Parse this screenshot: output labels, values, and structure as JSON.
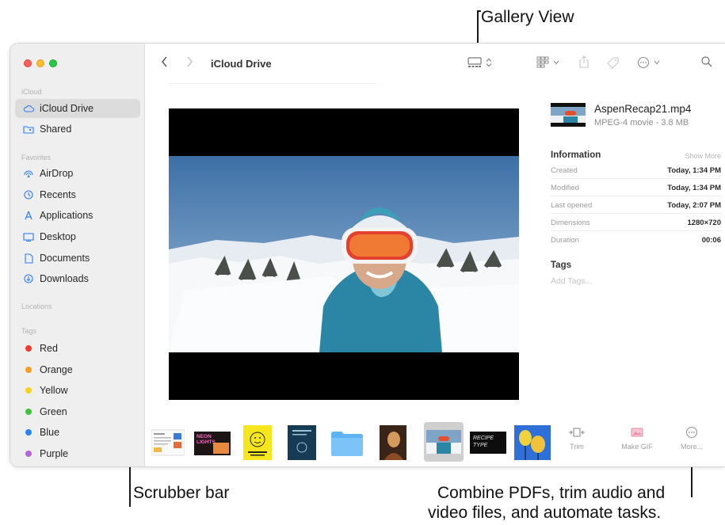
{
  "callouts": {
    "gallery_view": "Gallery View",
    "scrubber_bar": "Scrubber bar",
    "actions_line1": "Combine PDFs, trim audio and",
    "actions_line2": "video files, and automate tasks."
  },
  "toolbar": {
    "title": "iCloud Drive"
  },
  "sidebar": {
    "sections": {
      "icloud": "iCloud",
      "favorites": "Favorites",
      "locations": "Locations",
      "tags": "Tags"
    },
    "icloud_items": [
      {
        "label": "iCloud Drive",
        "icon": "cloud-icon",
        "selected": true
      },
      {
        "label": "Shared",
        "icon": "shared-folder-icon"
      }
    ],
    "favorites": [
      {
        "label": "AirDrop",
        "icon": "airdrop-icon"
      },
      {
        "label": "Recents",
        "icon": "clock-icon"
      },
      {
        "label": "Applications",
        "icon": "applications-icon"
      },
      {
        "label": "Desktop",
        "icon": "desktop-icon"
      },
      {
        "label": "Documents",
        "icon": "document-icon"
      },
      {
        "label": "Downloads",
        "icon": "download-icon"
      }
    ],
    "tags": [
      {
        "label": "Red",
        "color": "#f23b30"
      },
      {
        "label": "Orange",
        "color": "#f79d1f"
      },
      {
        "label": "Yellow",
        "color": "#f7d21a"
      },
      {
        "label": "Green",
        "color": "#3cc43c"
      },
      {
        "label": "Blue",
        "color": "#2b82f2"
      },
      {
        "label": "Purple",
        "color": "#b565d9"
      }
    ]
  },
  "file": {
    "name": "AspenRecap21.mp4",
    "kind": "MPEG-4 movie - 3.8 MB",
    "information_label": "Information",
    "show_more": "Show More",
    "rows": [
      {
        "key": "Created",
        "value": "Today, 1:34 PM"
      },
      {
        "key": "Modified",
        "value": "Today, 1:34 PM"
      },
      {
        "key": "Last opened",
        "value": "Today, 2:07 PM"
      },
      {
        "key": "Dimensions",
        "value": "1280×720"
      },
      {
        "key": "Duration",
        "value": "00:06"
      }
    ],
    "tags_label": "Tags",
    "add_tags_placeholder": "Add Tags..."
  },
  "scrubber": {
    "thumb_neon_text": "NEON LIGHTS",
    "thumb_type_text": "RECIPE TYPE"
  },
  "actions": [
    {
      "label": "Trim",
      "icon": "trim-icon"
    },
    {
      "label": "Make GIF",
      "icon": "make-gif-icon"
    },
    {
      "label": "More...",
      "icon": "more-icon"
    }
  ]
}
